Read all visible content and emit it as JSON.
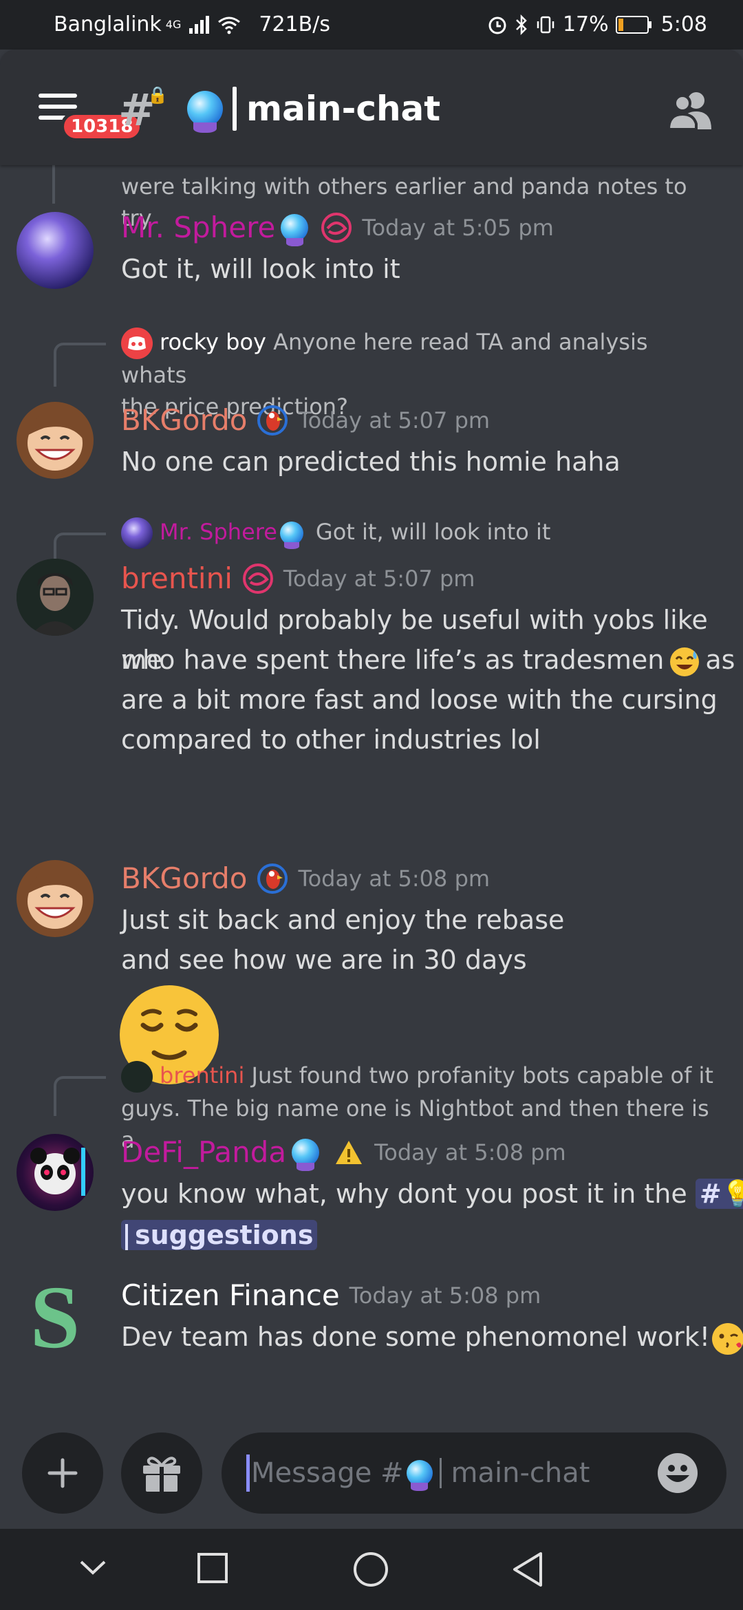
{
  "status_bar": {
    "carrier": "Banglalink",
    "network": "4G",
    "speed": "721B/s",
    "battery": "17%",
    "battery_level": 0.17,
    "time": "5:08"
  },
  "header": {
    "badge_count": "10318",
    "channel_name": "main-chat"
  },
  "messages": {
    "m0": {
      "text": "were talking with others earlier and panda notes to try"
    },
    "m1": {
      "author": "Mr. Sphere",
      "author_color": "#c21b9d",
      "time": "Today at 5:05 pm",
      "text": "Got it, will look into it"
    },
    "m2": {
      "reply_author": "rocky boy",
      "reply_text_1": "Anyone here read TA and analysis whats",
      "reply_text_2": "the price prediction?",
      "author": "BKGordo",
      "author_color": "#e67e6a",
      "time": "Today at 5:07 pm",
      "text": "No one can predicted this homie haha"
    },
    "m3": {
      "reply_author": "Mr. Sphere",
      "reply_text": "Got it, will look into it",
      "author": "brentini",
      "author_color": "#e8554e",
      "time": "Today at 5:07 pm",
      "line1": "Tidy. Would probably be useful with yobs like me",
      "line2a": "who have spent there life’s as tradesmen",
      "line2b": "as we",
      "line3": "are a bit more fast and loose with the cursing",
      "line4": "compared to other industries lol"
    },
    "m4": {
      "author": "BKGordo",
      "author_color": "#e67e6a",
      "time": "Today at 5:08 pm",
      "line1": "Just sit back and enjoy the rebase",
      "line2": "and see how we are in 30 days"
    },
    "m5": {
      "reply_author": "brentini",
      "reply_text_1": "Just found two profanity bots capable of it",
      "reply_text_2": "guys. The big name one is Nightbot and then there is a",
      "author": "DeFi_Panda",
      "author_color": "#c21b9d",
      "time": "Today at 5:08 pm",
      "text": "you know what, why dont you post it in the",
      "mention": "suggestions"
    },
    "m6": {
      "author": "Citizen Finance",
      "author_color": "#ffffff",
      "time": "Today at 5:08 pm",
      "text": "Dev team has done some phenomonel work!"
    }
  },
  "input": {
    "placeholder_prefix": "Message #",
    "placeholder_channel": "main-chat"
  },
  "icons": [
    "hamburger-icon",
    "hashtag-lock-icon",
    "crystal-ball-icon",
    "members-icon",
    "plus-icon",
    "gift-icon",
    "emoji-icon",
    "back-icon",
    "home-icon",
    "recents-icon",
    "collapse-icon"
  ]
}
